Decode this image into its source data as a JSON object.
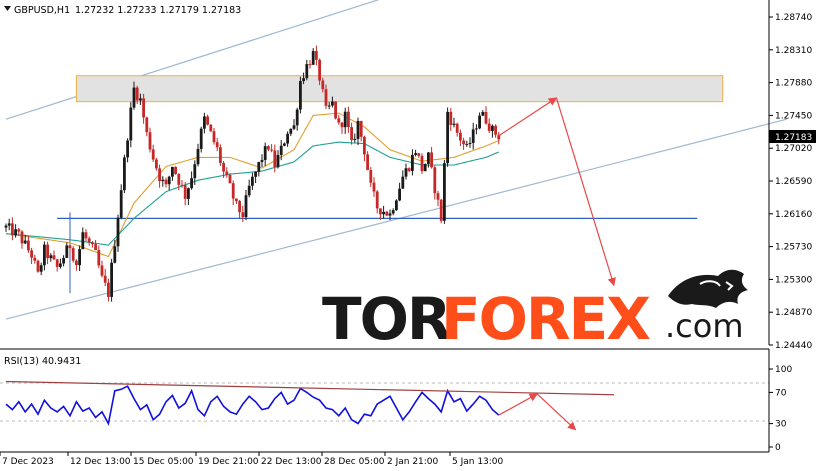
{
  "header": {
    "symbol_label": "GBPUSD,H1",
    "ohlc_label": "1.27232 1.27233 1.27179 1.27183"
  },
  "rsi_header": {
    "label": "RSI(13) 40.9431"
  },
  "logo": {
    "tor": "TOR",
    "forex": "FOREX",
    "dotcom": ".com"
  },
  "colors": {
    "background": "#ffffff",
    "candle_bull": "#1a1a1a",
    "candle_bear": "#c62828",
    "ma_fast": "#e0a030",
    "ma_slow": "#20a090",
    "channel": "#9fb8d0",
    "support": "#3060c0",
    "resistance_zone_fill": "#e2e2e2",
    "resistance_zone_border": "#f0b040",
    "forecast_arrow": "#e84848",
    "rsi_line": "#1010e0",
    "rsi_trendline": "#a04040",
    "logo_dark": "#1a1a1a",
    "logo_accent": "#ff4e1a"
  },
  "chart_data": [
    {
      "type": "candlestick",
      "symbol": "GBPUSD",
      "timeframe": "H1",
      "last_price": 1.27183,
      "ohlc_last": {
        "open": 1.27232,
        "high": 1.27233,
        "low": 1.27179,
        "close": 1.27183
      },
      "ylim": [
        1.2444,
        1.2874
      ],
      "y_ticks": [
        "1.28740",
        "1.28310",
        "1.27880",
        "1.27450",
        "1.27020",
        "1.26590",
        "1.26160",
        "1.25730",
        "1.25300",
        "1.24870",
        "1.24440"
      ],
      "last_price_label": "1.27183",
      "x_ticks": [
        "7 Dec 2023",
        "12 Dec 13:00",
        "15 Dec 05:00",
        "19 Dec 21:00",
        "22 Dec 13:00",
        "28 Dec 05:00",
        "2 Jan 21:00",
        "5 Jan 13:00"
      ],
      "price_path": [
        [
          0,
          1.2598
        ],
        [
          2,
          1.2588
        ],
        [
          4,
          1.2562
        ],
        [
          5,
          1.2535
        ],
        [
          6,
          1.2568
        ],
        [
          8,
          1.2545
        ],
        [
          10,
          1.2575
        ],
        [
          11,
          1.255
        ],
        [
          12,
          1.259
        ],
        [
          14,
          1.2562
        ],
        [
          15,
          1.253
        ],
        [
          16,
          1.2512
        ],
        [
          17,
          1.258
        ],
        [
          18,
          1.265
        ],
        [
          19,
          1.272
        ],
        [
          20,
          1.278
        ],
        [
          21,
          1.2765
        ],
        [
          22,
          1.272
        ],
        [
          23,
          1.269
        ],
        [
          24,
          1.2665
        ],
        [
          25,
          1.265
        ],
        [
          26,
          1.268
        ],
        [
          27,
          1.266
        ],
        [
          28,
          1.264
        ],
        [
          29,
          1.2665
        ],
        [
          30,
          1.2705
        ],
        [
          31,
          1.274
        ],
        [
          32,
          1.272
        ],
        [
          33,
          1.27
        ],
        [
          34,
          1.267
        ],
        [
          35,
          1.265
        ],
        [
          36,
          1.2625
        ],
        [
          37,
          1.2615
        ],
        [
          38,
          1.265
        ],
        [
          39,
          1.267
        ],
        [
          40,
          1.269
        ],
        [
          41,
          1.2705
        ],
        [
          42,
          1.268
        ],
        [
          43,
          1.27
        ],
        [
          44,
          1.2725
        ],
        [
          45,
          1.273
        ],
        [
          46,
          1.279
        ],
        [
          47,
          1.281
        ],
        [
          48,
          1.2825
        ],
        [
          49,
          1.2795
        ],
        [
          50,
          1.275
        ],
        [
          51,
          1.276
        ],
        [
          52,
          1.273
        ],
        [
          53,
          1.2745
        ],
        [
          54,
          1.2705
        ],
        [
          55,
          1.2735
        ],
        [
          56,
          1.27
        ],
        [
          57,
          1.265
        ],
        [
          58,
          1.2625
        ],
        [
          59,
          1.262
        ],
        [
          60,
          1.2615
        ],
        [
          61,
          1.264
        ],
        [
          62,
          1.2665
        ],
        [
          63,
          1.268
        ],
        [
          64,
          1.27
        ],
        [
          65,
          1.2675
        ],
        [
          66,
          1.269
        ],
        [
          67,
          1.265
        ],
        [
          68,
          1.261
        ],
        [
          69,
          1.275
        ],
        [
          70,
          1.273
        ],
        [
          71,
          1.2715
        ],
        [
          72,
          1.27
        ],
        [
          73,
          1.272
        ],
        [
          74,
          1.2748
        ],
        [
          75,
          1.274
        ],
        [
          76,
          1.2725
        ],
        [
          77,
          1.27183
        ]
      ],
      "moving_averages": [
        {
          "color": "#e0a030",
          "path": [
            [
              0,
              1.259
            ],
            [
              10,
              1.2578
            ],
            [
              16,
              1.256
            ],
            [
              20,
              1.263
            ],
            [
              25,
              1.2678
            ],
            [
              30,
              1.269
            ],
            [
              35,
              1.269
            ],
            [
              40,
              1.2676
            ],
            [
              45,
              1.27
            ],
            [
              48,
              1.2745
            ],
            [
              52,
              1.2748
            ],
            [
              56,
              1.273
            ],
            [
              60,
              1.27
            ],
            [
              65,
              1.2685
            ],
            [
              70,
              1.269
            ],
            [
              75,
              1.2705
            ],
            [
              77,
              1.2712
            ]
          ]
        },
        {
          "color": "#20a090",
          "path": [
            [
              0,
              1.259
            ],
            [
              10,
              1.2582
            ],
            [
              16,
              1.2575
            ],
            [
              20,
              1.261
            ],
            [
              25,
              1.2645
            ],
            [
              30,
              1.266
            ],
            [
              35,
              1.2668
            ],
            [
              40,
              1.2672
            ],
            [
              45,
              1.2684
            ],
            [
              48,
              1.2705
            ],
            [
              52,
              1.271
            ],
            [
              56,
              1.2708
            ],
            [
              60,
              1.269
            ],
            [
              65,
              1.268
            ],
            [
              70,
              1.268
            ],
            [
              75,
              1.269
            ],
            [
              77,
              1.2697
            ]
          ]
        }
      ],
      "channel_lines": [
        {
          "from": [
            0,
            1.274
          ],
          "to": [
            65,
            1.2915
          ]
        },
        {
          "from": [
            0,
            1.2478
          ],
          "to": [
            122,
            1.274
          ]
        }
      ],
      "support_level": {
        "price": 1.261,
        "from_x": 8,
        "to_x": 108
      },
      "resistance_zone": {
        "price_low": 1.2763,
        "price_high": 1.2797,
        "from_x": 11,
        "to_x": 112
      },
      "forecast_path": [
        [
          77,
          1.27183
        ],
        [
          86,
          1.2768
        ],
        [
          95,
          1.2522
        ]
      ]
    },
    {
      "type": "line",
      "name": "RSI(13)",
      "last_value": 40.9431,
      "ylim": [
        0,
        100
      ],
      "y_ticks": [
        "100",
        "70",
        "30",
        "0"
      ],
      "values": [
        55,
        48,
        58,
        45,
        55,
        42,
        60,
        50,
        45,
        52,
        40,
        58,
        46,
        50,
        38,
        45,
        30,
        72,
        74,
        78,
        62,
        48,
        54,
        35,
        42,
        58,
        66,
        50,
        56,
        72,
        48,
        40,
        58,
        65,
        52,
        45,
        42,
        55,
        65,
        58,
        48,
        50,
        62,
        70,
        55,
        60,
        75,
        70,
        64,
        60,
        50,
        48,
        40,
        50,
        35,
        30,
        42,
        40,
        55,
        60,
        65,
        50,
        35,
        45,
        58,
        70,
        62,
        55,
        45,
        72,
        58,
        62,
        46,
        55,
        65,
        60,
        48,
        40.9431
      ],
      "trendline": {
        "from": [
          0,
          84
        ],
        "to": [
          95,
          67
        ]
      },
      "forecast_path": [
        [
          77,
          40.9431
        ],
        [
          83,
          68
        ],
        [
          89,
          22
        ]
      ]
    }
  ]
}
